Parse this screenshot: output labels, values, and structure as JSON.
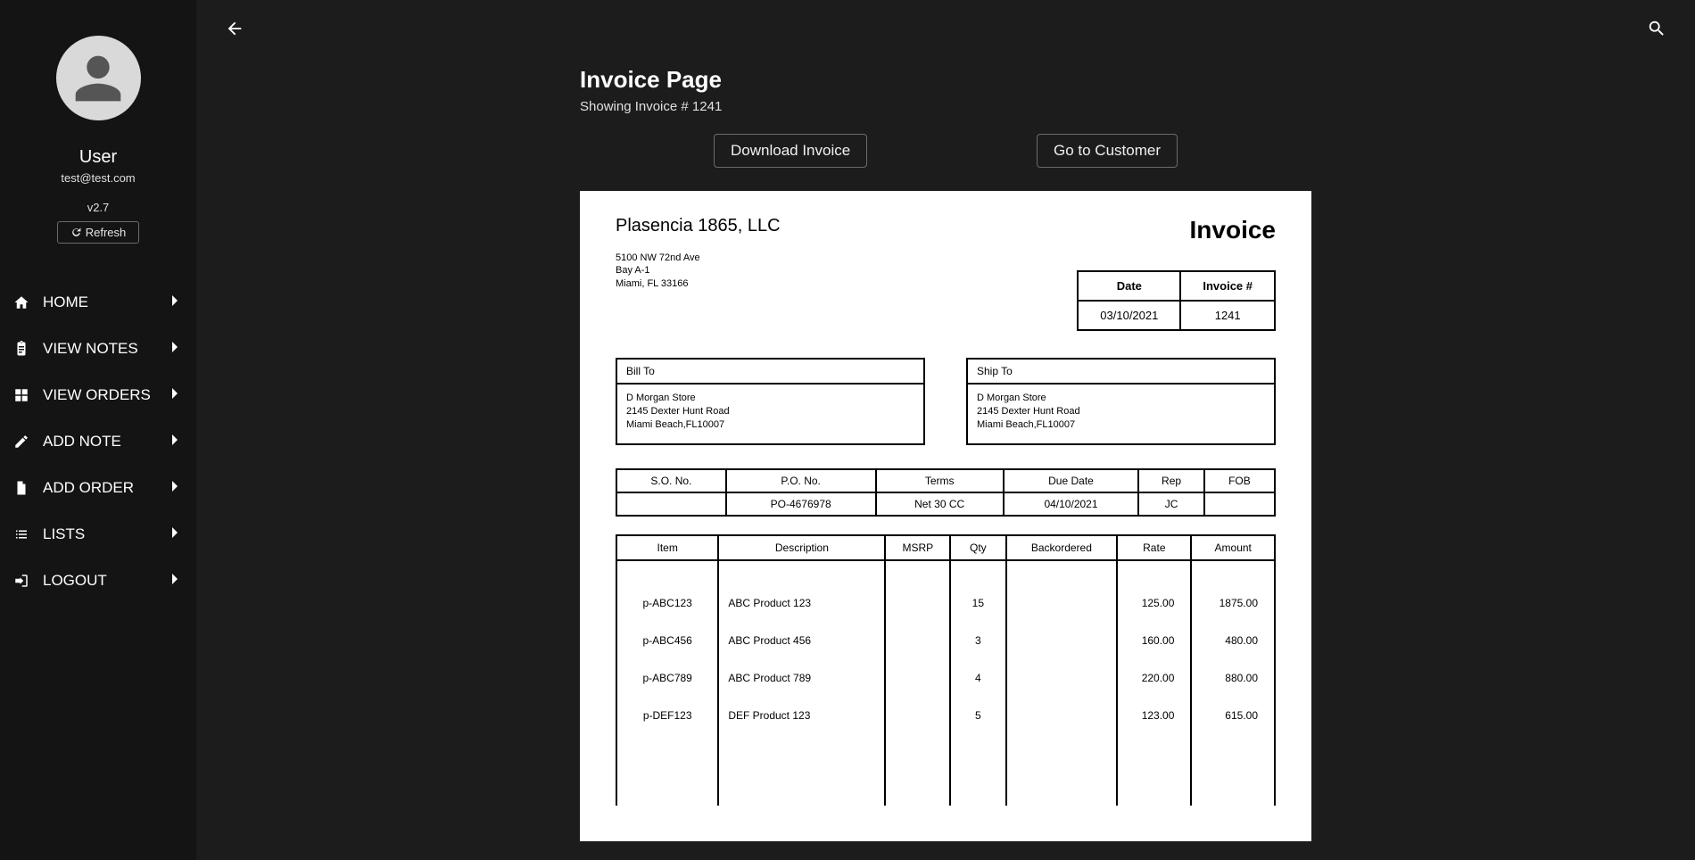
{
  "sidebar": {
    "user_name": "User",
    "user_email": "test@test.com",
    "version": "v2.7",
    "refresh_label": "Refresh",
    "items": [
      {
        "label": "HOME"
      },
      {
        "label": "VIEW NOTES"
      },
      {
        "label": "VIEW ORDERS"
      },
      {
        "label": "ADD NOTE"
      },
      {
        "label": "ADD ORDER"
      },
      {
        "label": "LISTS"
      },
      {
        "label": "LOGOUT"
      }
    ]
  },
  "page": {
    "title": "Invoice Page",
    "subtitle": "Showing Invoice # 1241",
    "download_label": "Download Invoice",
    "goto_customer_label": "Go to Customer"
  },
  "invoice": {
    "company_name": "Plasencia 1865, LLC",
    "company_addr_line1": "5100 NW 72nd Ave",
    "company_addr_line2": "Bay A-1",
    "company_addr_line3": "Miami, FL 33166",
    "invoice_heading": "Invoice",
    "date_label": "Date",
    "invoice_num_label": "Invoice #",
    "date": "03/10/2021",
    "number": "1241",
    "bill_to_label": "Bill To",
    "ship_to_label": "Ship To",
    "bill_to": {
      "name": "D Morgan Store",
      "street": "2145 Dexter Hunt Road",
      "citystate": "Miami Beach,FL10007"
    },
    "ship_to": {
      "name": "D Morgan Store",
      "street": "2145 Dexter Hunt Road",
      "citystate": "Miami Beach,FL10007"
    },
    "meta": {
      "headers": {
        "so": "S.O. No.",
        "po": "P.O. No.",
        "terms": "Terms",
        "due": "Due Date",
        "rep": "Rep",
        "fob": "FOB"
      },
      "values": {
        "so": "",
        "po": "PO-4676978",
        "terms": "Net 30 CC",
        "due": "04/10/2021",
        "rep": "JC",
        "fob": ""
      }
    },
    "items_headers": {
      "item": "Item",
      "desc": "Description",
      "msrp": "MSRP",
      "qty": "Qty",
      "back": "Backordered",
      "rate": "Rate",
      "amount": "Amount"
    },
    "items": [
      {
        "item": "p-ABC123",
        "desc": "ABC Product 123",
        "msrp": "",
        "qty": "15",
        "back": "",
        "rate": "125.00",
        "amount": "1875.00"
      },
      {
        "item": "p-ABC456",
        "desc": "ABC Product 456",
        "msrp": "",
        "qty": "3",
        "back": "",
        "rate": "160.00",
        "amount": "480.00"
      },
      {
        "item": "p-ABC789",
        "desc": "ABC Product 789",
        "msrp": "",
        "qty": "4",
        "back": "",
        "rate": "220.00",
        "amount": "880.00"
      },
      {
        "item": "p-DEF123",
        "desc": "DEF Product 123",
        "msrp": "",
        "qty": "5",
        "back": "",
        "rate": "123.00",
        "amount": "615.00"
      }
    ]
  }
}
